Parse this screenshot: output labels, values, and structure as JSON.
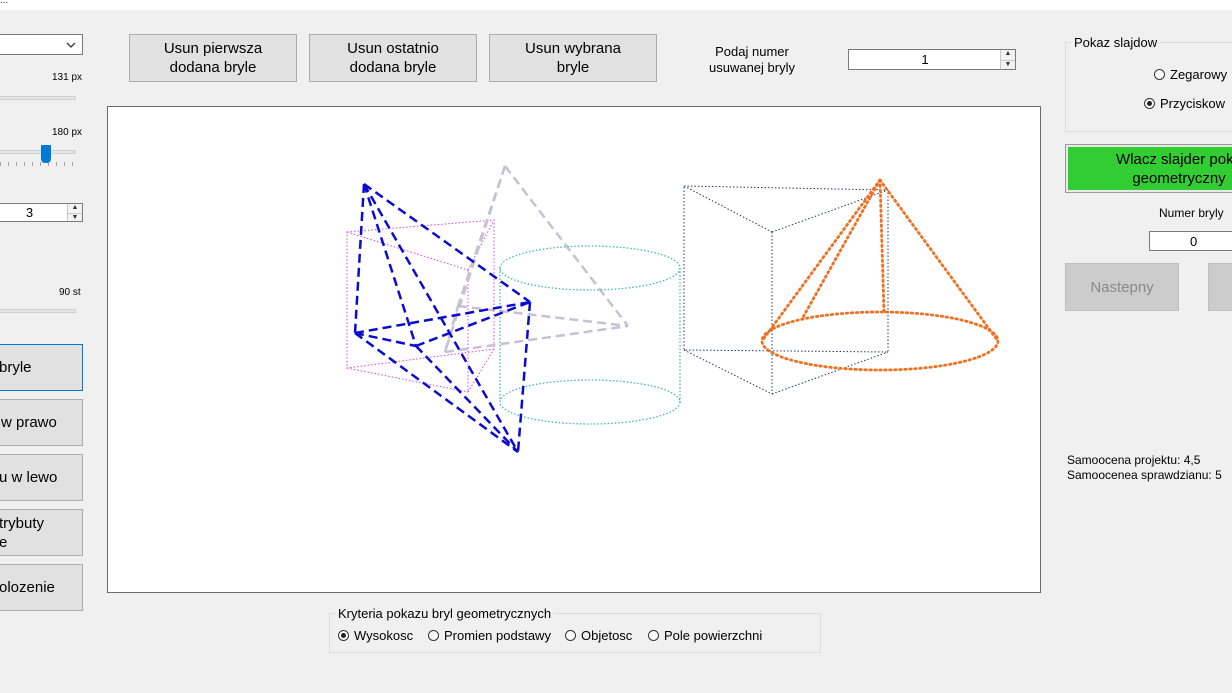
{
  "window": {
    "title_fragment": "..."
  },
  "top": {
    "remove_first_label": "Usun pierwsza\ndodana bryle",
    "remove_last_label": "Usun ostatnio\ndodana bryle",
    "remove_selected_label": "Usun wybrana\nbryle",
    "remove_number_caption": "Podaj numer\nusuwanej bryly",
    "remove_number_value": "1"
  },
  "left": {
    "slider1_value": "131 px",
    "slider2_value": "180 px",
    "slider2_level": 0.45,
    "sides_value": "3",
    "slider3_value": "90 st",
    "btn_add": "bryle",
    "btn_right": "w prawo",
    "btn_left": "u w lewo",
    "btn_attrs": "trybuty\ne",
    "btn_position": "olozenie"
  },
  "slideshow": {
    "group_caption": "Pokaz slajdow",
    "opt_clock": "Zegarowy",
    "opt_button": "Przyciskow",
    "start_label": "Wlacz slajder poka\ngeometryczny",
    "number_caption": "Numer bryly",
    "number_value": "0",
    "next_label": "Nastepny"
  },
  "notes": {
    "project": "Samoocena projektu: 4,5",
    "test": "Samoocenea sprawdzianu: 5"
  },
  "criteria": {
    "caption": "Kryteria pokazu bryl geometrycznych",
    "opt_height": "Wysokosc",
    "opt_radius": "Promien podstawy",
    "opt_volume": "Objetosc",
    "opt_area": "Pole powierzchni"
  },
  "colors": {
    "pyramid_blue": "#0b0bd0",
    "prism_magenta": "#e040e0",
    "pyramid_gray": "#c8c0d4",
    "cylinder_teal": "#3cb9b0",
    "box_navy": "#2a3560",
    "cone_orange": "#f07020",
    "start_green": "#32cd32"
  }
}
